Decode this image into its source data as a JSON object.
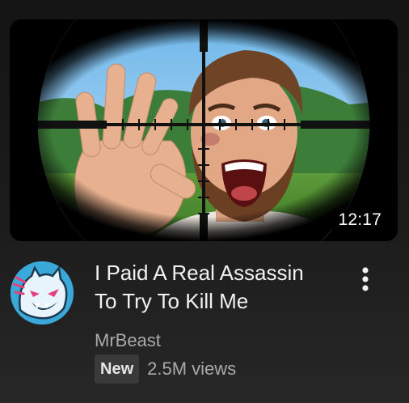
{
  "video": {
    "duration": "12:17",
    "title": "I Paid A Real Assassin\nTo Try To Kill Me",
    "channel": "MrBeast",
    "badge": "New",
    "views": "2.5M views"
  },
  "icons": {
    "avatar": "mrbeast-panther-logo",
    "menu": "more-vertical-icon"
  },
  "colors": {
    "background": "#1b1b1b",
    "title_text": "#f1f1f1",
    "secondary_text": "#aaaaaa",
    "badge_bg": "#3a3a3a",
    "avatar_bg": "#3aa8d8"
  }
}
